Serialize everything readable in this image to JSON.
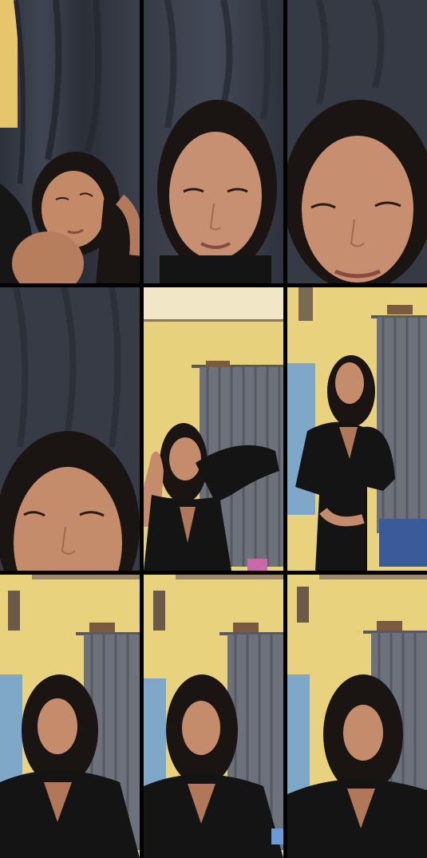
{
  "frames": [
    {
      "scene": "dark-curtain",
      "subject": "reclining-face"
    },
    {
      "scene": "dark-curtain",
      "subject": "close-face"
    },
    {
      "scene": "dark-curtain",
      "subject": "close-face-low"
    },
    {
      "scene": "dark-curtain",
      "subject": "close-face-very-low"
    },
    {
      "scene": "room",
      "subject": "posing-arm-up"
    },
    {
      "scene": "room",
      "subject": "standing"
    },
    {
      "scene": "room",
      "subject": "seated-center"
    },
    {
      "scene": "room",
      "subject": "seated-center"
    },
    {
      "scene": "room",
      "subject": "seated-right"
    }
  ],
  "colors": {
    "background": "#000000",
    "curtain_dark": "#3a3f4a",
    "wall": "#e9d27d",
    "curtain_grey": "#6b6f78",
    "skin": "#c58c6b",
    "hair": "#1a1512",
    "clothing": "#141414"
  }
}
